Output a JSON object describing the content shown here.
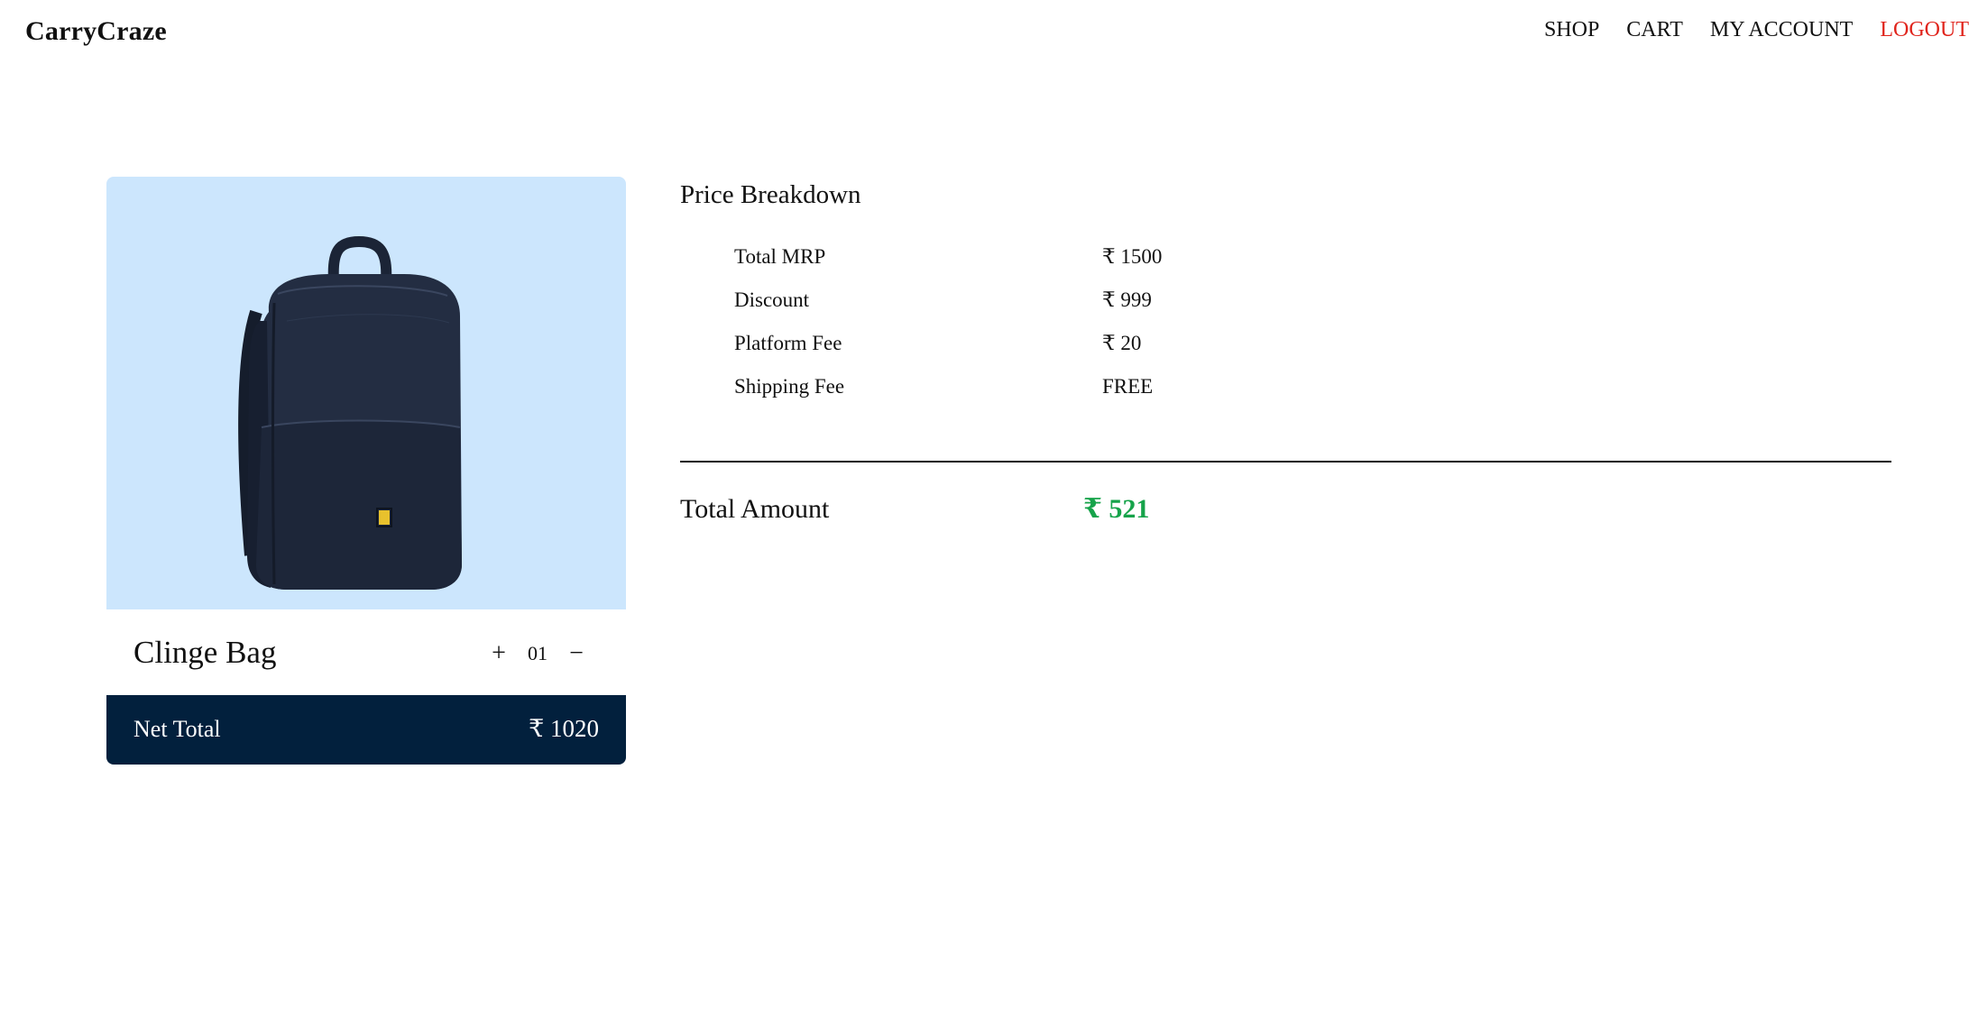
{
  "header": {
    "brand": "CarryCraze",
    "nav": [
      {
        "label": "SHOP"
      },
      {
        "label": "CART"
      },
      {
        "label": "MY ACCOUNT"
      },
      {
        "label": "LOGOUT",
        "color": "#e0241c"
      }
    ]
  },
  "cart_item": {
    "name": "Clinge Bag",
    "quantity": "01",
    "increment_label": "+",
    "decrement_label": "−",
    "image_icon": "backpack-image",
    "image_bg": "#cce6fd",
    "net_total_label": "Net Total",
    "net_total_value": "₹ 1020"
  },
  "price_breakdown": {
    "title": "Price Breakdown",
    "rows": [
      {
        "label": "Total MRP",
        "value": "₹ 1500"
      },
      {
        "label": "Discount",
        "value": "₹ 999"
      },
      {
        "label": "Platform Fee",
        "value": "₹ 20"
      },
      {
        "label": "Shipping Fee",
        "value": "FREE"
      }
    ],
    "total_label": "Total Amount",
    "total_value": "₹ 521",
    "total_color": "#16a34a"
  },
  "colors": {
    "navy": "#02203d",
    "image_bg": "#cce6fd",
    "logout": "#e0241c",
    "total_green": "#16a34a"
  }
}
